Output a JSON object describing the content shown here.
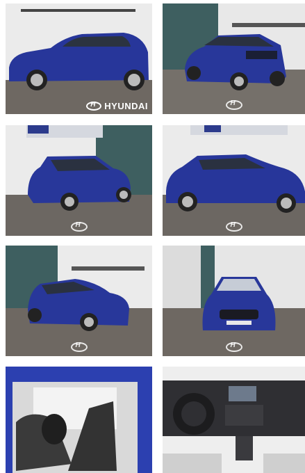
{
  "gallery": {
    "brand_wordmark": "HYUNDAI",
    "photos": [
      {
        "view": "side-left"
      },
      {
        "view": "rear-quarter"
      },
      {
        "view": "rear-left"
      },
      {
        "view": "side-right"
      },
      {
        "view": "front-quarter"
      },
      {
        "view": "front"
      },
      {
        "view": "interior-seats"
      },
      {
        "view": "dashboard"
      }
    ]
  }
}
